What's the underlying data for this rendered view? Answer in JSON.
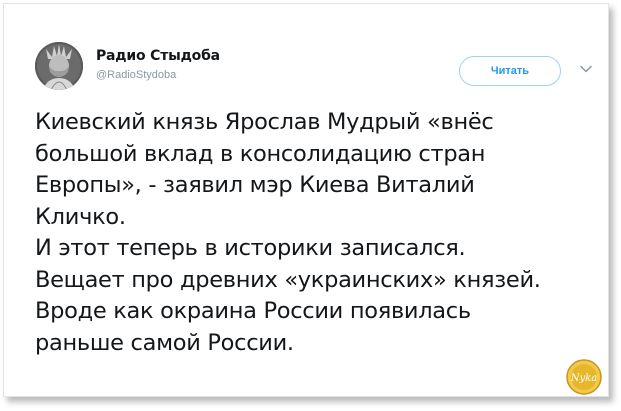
{
  "author": {
    "display_name": "Радио Стыдоба",
    "handle": "@RadioStydoba",
    "avatar_icon": "statue-of-liberty-facepalm-avatar"
  },
  "actions": {
    "follow_label": "Читать",
    "menu_icon": "chevron-down-icon"
  },
  "tweet": {
    "lines": [
      "Киевский князь Ярослав Мудрый «внёс",
      "большой вклад в консолидацию стран",
      "Европы», - заявил мэр Киева Виталий",
      "Кличко.",
      "И этот теперь в историки записался.",
      "Вещает про древних «украинских» князей.",
      "Вроде как окраина России появилась",
      "раньше самой России."
    ]
  },
  "watermark": {
    "icon": "site-logo-badge",
    "text": "Nyka"
  },
  "colors": {
    "accent": "#1d9bf0",
    "text": "#14171a",
    "secondary_text": "#8899a6",
    "button_border": "#9fd2f4",
    "logo_gold": "#e8b62a"
  }
}
